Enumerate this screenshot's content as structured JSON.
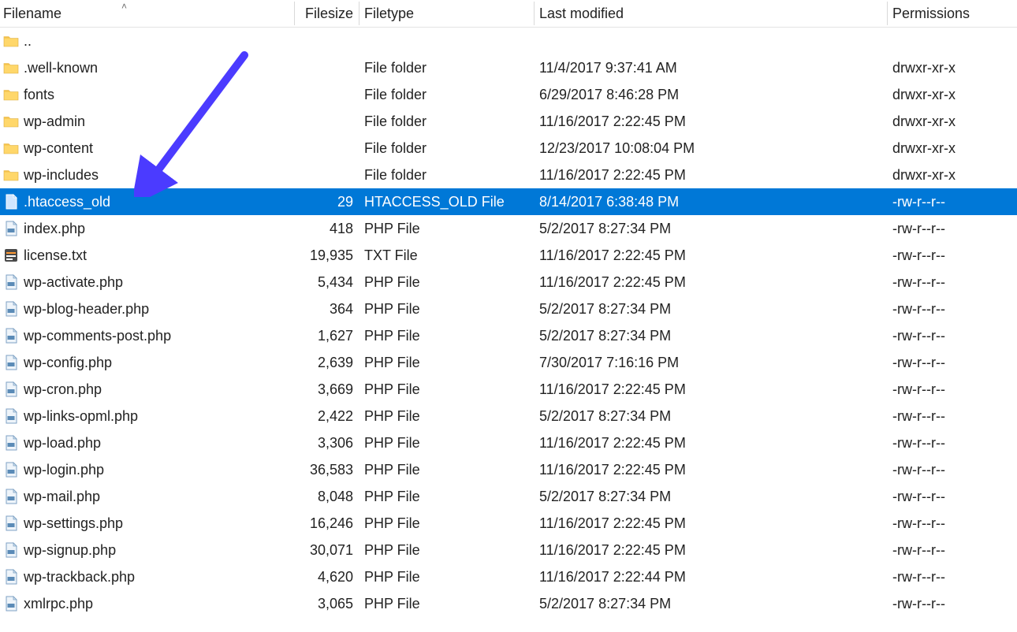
{
  "columns": {
    "filename": "Filename",
    "filesize": "Filesize",
    "filetype": "Filetype",
    "last_modified": "Last modified",
    "permissions": "Permissions"
  },
  "rows": [
    {
      "icon": "folder",
      "name": "..",
      "size": "",
      "type": "",
      "modified": "",
      "perm": "",
      "selected": false
    },
    {
      "icon": "folder",
      "name": ".well-known",
      "size": "",
      "type": "File folder",
      "modified": "11/4/2017 9:37:41 AM",
      "perm": "drwxr-xr-x",
      "selected": false
    },
    {
      "icon": "folder",
      "name": "fonts",
      "size": "",
      "type": "File folder",
      "modified": "6/29/2017 8:46:28 PM",
      "perm": "drwxr-xr-x",
      "selected": false
    },
    {
      "icon": "folder",
      "name": "wp-admin",
      "size": "",
      "type": "File folder",
      "modified": "11/16/2017 2:22:45 PM",
      "perm": "drwxr-xr-x",
      "selected": false
    },
    {
      "icon": "folder",
      "name": "wp-content",
      "size": "",
      "type": "File folder",
      "modified": "12/23/2017 10:08:04 PM",
      "perm": "drwxr-xr-x",
      "selected": false
    },
    {
      "icon": "folder",
      "name": "wp-includes",
      "size": "",
      "type": "File folder",
      "modified": "11/16/2017 2:22:45 PM",
      "perm": "drwxr-xr-x",
      "selected": false
    },
    {
      "icon": "file",
      "name": ".htaccess_old",
      "size": "29",
      "type": "HTACCESS_OLD File",
      "modified": "8/14/2017 6:38:48 PM",
      "perm": "-rw-r--r--",
      "selected": true
    },
    {
      "icon": "php",
      "name": "index.php",
      "size": "418",
      "type": "PHP File",
      "modified": "5/2/2017 8:27:34 PM",
      "perm": "-rw-r--r--",
      "selected": false
    },
    {
      "icon": "txt",
      "name": "license.txt",
      "size": "19,935",
      "type": "TXT File",
      "modified": "11/16/2017 2:22:45 PM",
      "perm": "-rw-r--r--",
      "selected": false
    },
    {
      "icon": "php",
      "name": "wp-activate.php",
      "size": "5,434",
      "type": "PHP File",
      "modified": "11/16/2017 2:22:45 PM",
      "perm": "-rw-r--r--",
      "selected": false
    },
    {
      "icon": "php",
      "name": "wp-blog-header.php",
      "size": "364",
      "type": "PHP File",
      "modified": "5/2/2017 8:27:34 PM",
      "perm": "-rw-r--r--",
      "selected": false
    },
    {
      "icon": "php",
      "name": "wp-comments-post.php",
      "size": "1,627",
      "type": "PHP File",
      "modified": "5/2/2017 8:27:34 PM",
      "perm": "-rw-r--r--",
      "selected": false
    },
    {
      "icon": "php",
      "name": "wp-config.php",
      "size": "2,639",
      "type": "PHP File",
      "modified": "7/30/2017 7:16:16 PM",
      "perm": "-rw-r--r--",
      "selected": false
    },
    {
      "icon": "php",
      "name": "wp-cron.php",
      "size": "3,669",
      "type": "PHP File",
      "modified": "11/16/2017 2:22:45 PM",
      "perm": "-rw-r--r--",
      "selected": false
    },
    {
      "icon": "php",
      "name": "wp-links-opml.php",
      "size": "2,422",
      "type": "PHP File",
      "modified": "5/2/2017 8:27:34 PM",
      "perm": "-rw-r--r--",
      "selected": false
    },
    {
      "icon": "php",
      "name": "wp-load.php",
      "size": "3,306",
      "type": "PHP File",
      "modified": "11/16/2017 2:22:45 PM",
      "perm": "-rw-r--r--",
      "selected": false
    },
    {
      "icon": "php",
      "name": "wp-login.php",
      "size": "36,583",
      "type": "PHP File",
      "modified": "11/16/2017 2:22:45 PM",
      "perm": "-rw-r--r--",
      "selected": false
    },
    {
      "icon": "php",
      "name": "wp-mail.php",
      "size": "8,048",
      "type": "PHP File",
      "modified": "5/2/2017 8:27:34 PM",
      "perm": "-rw-r--r--",
      "selected": false
    },
    {
      "icon": "php",
      "name": "wp-settings.php",
      "size": "16,246",
      "type": "PHP File",
      "modified": "11/16/2017 2:22:45 PM",
      "perm": "-rw-r--r--",
      "selected": false
    },
    {
      "icon": "php",
      "name": "wp-signup.php",
      "size": "30,071",
      "type": "PHP File",
      "modified": "11/16/2017 2:22:45 PM",
      "perm": "-rw-r--r--",
      "selected": false
    },
    {
      "icon": "php",
      "name": "wp-trackback.php",
      "size": "4,620",
      "type": "PHP File",
      "modified": "11/16/2017 2:22:44 PM",
      "perm": "-rw-r--r--",
      "selected": false
    },
    {
      "icon": "php",
      "name": "xmlrpc.php",
      "size": "3,065",
      "type": "PHP File",
      "modified": "5/2/2017 8:27:34 PM",
      "perm": "-rw-r--r--",
      "selected": false
    }
  ]
}
